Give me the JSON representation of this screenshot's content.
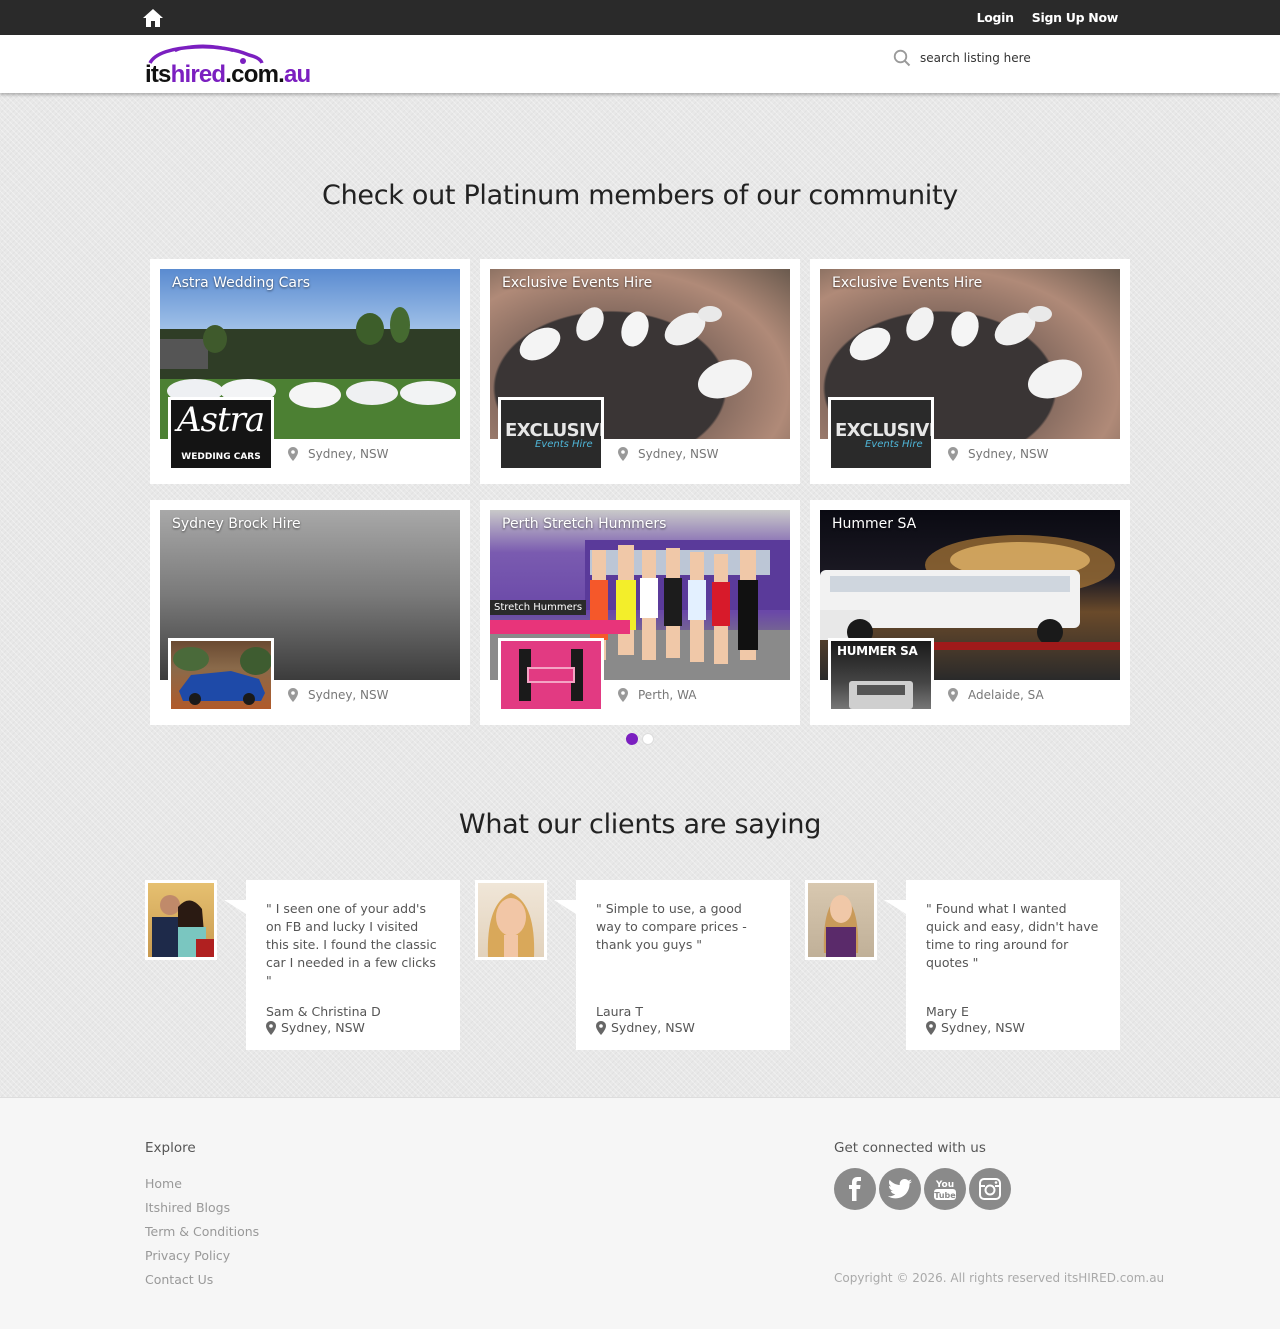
{
  "topbar": {
    "home_icon": "home-icon",
    "login_label": "Login",
    "signup_label": "Sign Up Now"
  },
  "header": {
    "logo": {
      "its": "its",
      "hired": "hired",
      "dotcom": ".com.",
      "au": "au"
    },
    "search_placeholder": "search listing here",
    "search_icon": "search-icon"
  },
  "platinum": {
    "title": "Check out Platinum members of our community",
    "listings": [
      {
        "name": "Astra Wedding Cars",
        "location": "Sydney, NSW",
        "thumb_text": "Astra",
        "thumb_sub": "WEDDING CARS"
      },
      {
        "name": "Exclusive Events Hire",
        "location": "Sydney, NSW",
        "thumb_text": "EXCLUSIVE",
        "thumb_sub": "Events Hire"
      },
      {
        "name": "Exclusive Events Hire",
        "location": "Sydney, NSW",
        "thumb_text": "EXCLUSIVE",
        "thumb_sub": "Events Hire"
      },
      {
        "name": "Sydney Brock Hire",
        "location": "Sydney, NSW"
      },
      {
        "name": "Perth Stretch Hummers",
        "location": "Perth, WA",
        "banner_text": "Stretch Hummers"
      },
      {
        "name": "Hummer SA",
        "location": "Adelaide, SA",
        "thumb_text": "HUMMER SA"
      }
    ],
    "carousel_pages": 2,
    "carousel_active": 1
  },
  "testimonials": {
    "title": "What our clients are saying",
    "items": [
      {
        "quote": "\" I seen one of your add's on FB and lucky I visited this site. I found the classic car I needed in a few clicks \"",
        "name": "Sam & Christina D",
        "location": "Sydney, NSW"
      },
      {
        "quote": "\" Simple to use, a good way to compare prices - thank you guys \"",
        "name": "Laura T",
        "location": "Sydney, NSW"
      },
      {
        "quote": "\" Found what I wanted quick and easy, didn't have time to ring around for quotes \"",
        "name": "Mary E",
        "location": "Sydney, NSW"
      }
    ]
  },
  "footer": {
    "explore_title": "Explore",
    "links": [
      "Home",
      "Itshired Blogs",
      "Term & Conditions",
      "Privacy Policy",
      "Contact Us"
    ],
    "connect_title": "Get connected with us",
    "socials": [
      "facebook-icon",
      "twitter-icon",
      "youtube-icon",
      "instagram-icon"
    ],
    "copyright": "Copyright © 2026. All rights reserved itsHIRED.com.au"
  },
  "colors": {
    "accent": "#7b1fc0",
    "topbar": "#2a2a2a",
    "social": "#8a8a8a"
  }
}
